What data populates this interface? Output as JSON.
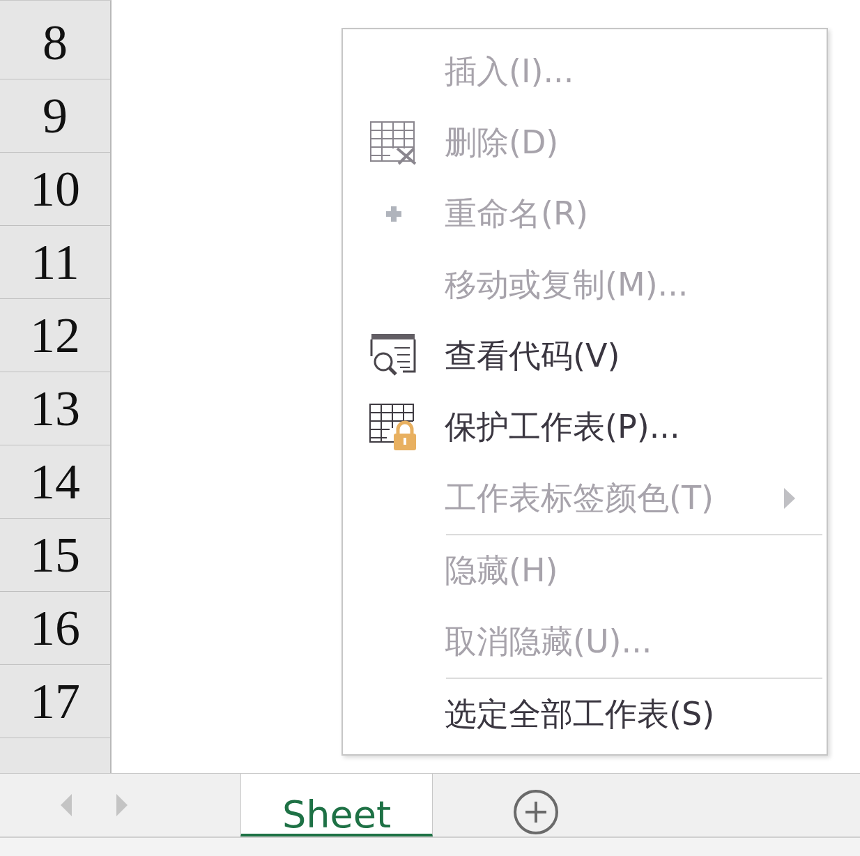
{
  "row_headers": [
    "8",
    "9",
    "10",
    "11",
    "12",
    "13",
    "14",
    "15",
    "16",
    "17"
  ],
  "context_menu": {
    "items": [
      {
        "kind": "item",
        "label": "插入(I)...",
        "disabled": true
      },
      {
        "kind": "item",
        "label": "删除(D)",
        "disabled": true
      },
      {
        "kind": "item",
        "label": "重命名(R)",
        "disabled": true
      },
      {
        "kind": "item",
        "label": "移动或复制(M)...",
        "disabled": true
      },
      {
        "kind": "item",
        "label": "查看代码(V)",
        "disabled": false
      },
      {
        "kind": "item",
        "label": "保护工作表(P)...",
        "disabled": false
      },
      {
        "kind": "item",
        "label": "工作表标签颜色(T)",
        "disabled": true,
        "submenu": true
      },
      {
        "kind": "separator"
      },
      {
        "kind": "item",
        "label": "隐藏(H)",
        "disabled": true
      },
      {
        "kind": "item",
        "label": "取消隐藏(U)...",
        "disabled": true
      },
      {
        "kind": "separator"
      },
      {
        "kind": "item",
        "label": "选定全部工作表(S)",
        "disabled": false
      }
    ]
  },
  "sheet_tabs": [
    {
      "label": "Sheet",
      "selected": true
    }
  ]
}
